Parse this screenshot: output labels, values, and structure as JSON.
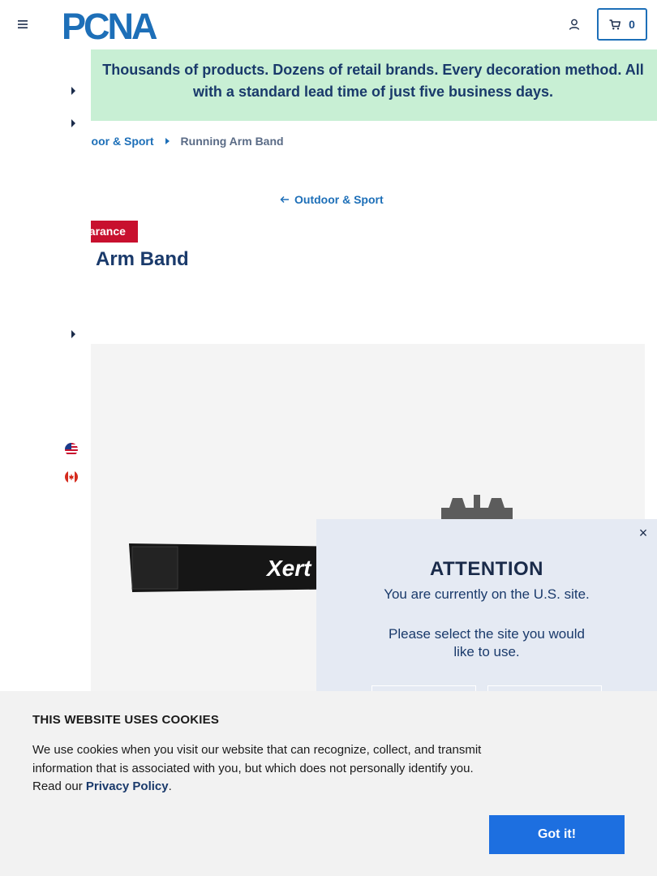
{
  "header": {
    "logo_text": "PCNA",
    "cart_count": "0"
  },
  "banner": {
    "text_line1": "Thousands of products. Dozens of retail brands. Every decoration method. All",
    "text_line2": "with a standard lead time of just five business days."
  },
  "breadcrumb": {
    "items": [
      {
        "label": "door & Sport"
      },
      {
        "label": "Running Arm Band"
      }
    ]
  },
  "back_link": {
    "label": "Outdoor & Sport"
  },
  "product": {
    "badge": "earance",
    "title": "Arm Band",
    "image_brand_text": "Xert"
  },
  "attention_modal": {
    "close_label": "×",
    "title": "ATTENTION",
    "line1": "You are currently on the U.S. site.",
    "line2": "Please select the site you would",
    "line3": "like to use."
  },
  "cookie_banner": {
    "title": "THIS WEBSITE USES COOKIES",
    "body_prefix": "We use cookies when you visit our website that can recognize, collect, and transmit information that is associated with you, but which does not personally identify you. Read our ",
    "link_label": "Privacy Policy",
    "body_suffix": ".",
    "button_label": "Got it!"
  },
  "icons": {
    "menu": "hamburger-icon",
    "user": "user-icon",
    "cart": "cart-icon",
    "flag_us": "us-flag-icon",
    "flag_ca": "canada-flag-icon"
  },
  "colors": {
    "brand_blue": "#1d6fb8",
    "banner_green": "#c8efd4",
    "clearance_red": "#c8102e",
    "cookie_button": "#1d6fe0",
    "modal_bg": "#e5eaf3"
  }
}
